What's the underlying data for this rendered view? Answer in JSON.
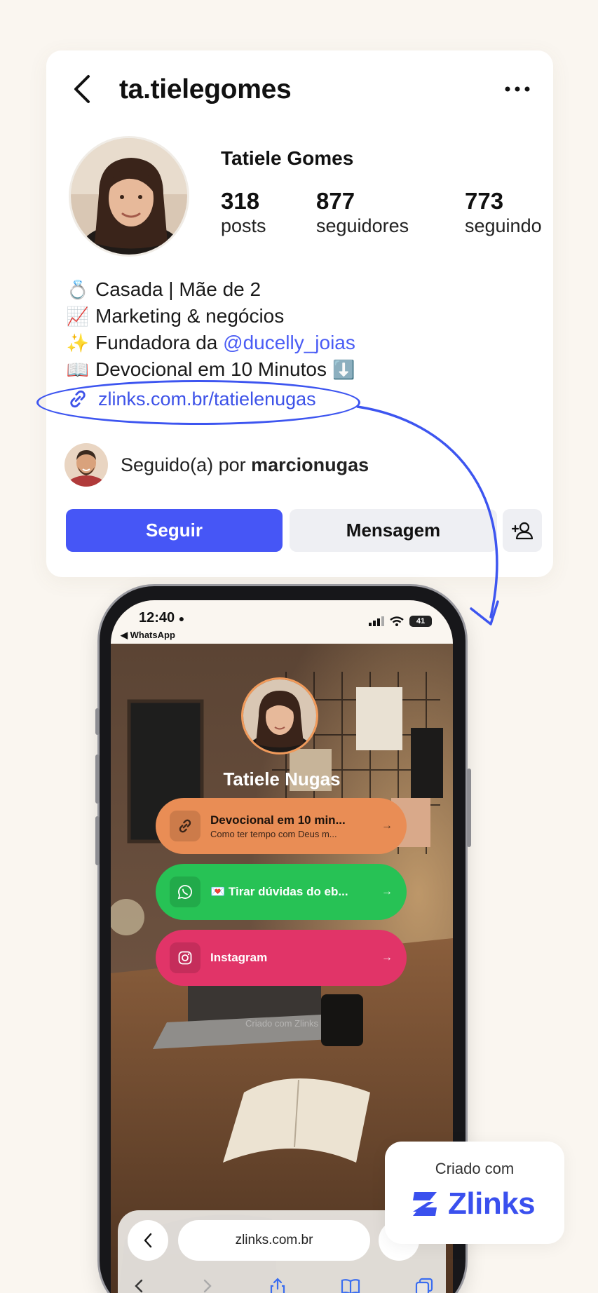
{
  "profile": {
    "username": "ta.tielegomes",
    "display_name": "Tatiele Gomes",
    "stats": [
      {
        "value": "318",
        "label": "posts"
      },
      {
        "value": "877",
        "label": "seguidores"
      },
      {
        "value": "773",
        "label": "seguindo"
      }
    ],
    "bio": [
      {
        "emoji": "💍",
        "text": "Casada | Mãe de 2"
      },
      {
        "emoji": "📈",
        "text": "Marketing & negócios"
      },
      {
        "emoji": "✨",
        "text": "Fundadora da ",
        "mention": "@ducelly_joias"
      },
      {
        "emoji": "📖",
        "text": "Devocional em 10 Minutos",
        "suffix": "⬇️"
      }
    ],
    "link": "zlinks.com.br/tatielenugas",
    "followed_by_prefix": "Seguido(a) por ",
    "followed_by_user": "marcionugas",
    "follow_label": "Seguir",
    "message_label": "Mensagem"
  },
  "phone": {
    "time": "12:40",
    "back_app": "◀ WhatsApp",
    "battery": "41",
    "page_name": "Tatiele Nugas",
    "links": [
      {
        "title": "Devocional em 10 min...",
        "subtitle": "Como ter tempo com Deus m...",
        "color": "#e98d55",
        "icon": "link-icon"
      },
      {
        "title": "💌 Tirar dúvidas do eb...",
        "subtitle": "",
        "color": "#27c255",
        "icon": "whatsapp-icon"
      },
      {
        "title": "Instagram",
        "subtitle": "",
        "color": "#e13468",
        "icon": "instagram-icon"
      }
    ],
    "credit": "Criado com Zlinks",
    "browser_url": "zlinks.com.br"
  },
  "badge": {
    "top": "Criado com",
    "brand": "Zlinks",
    "brand_color": "#3a50ee"
  },
  "colors": {
    "accent": "#4656f6",
    "link": "#3d52e8",
    "background": "#faf6f0"
  }
}
